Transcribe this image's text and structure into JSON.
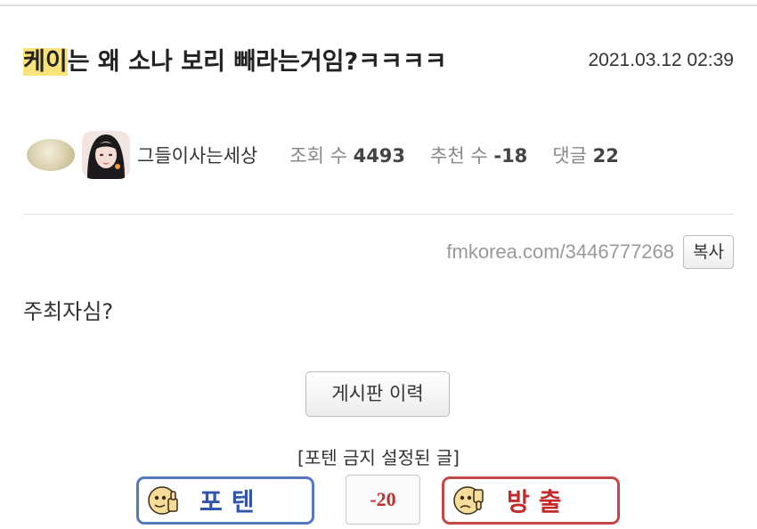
{
  "post": {
    "title_highlight": "케이",
    "title_rest": "는 왜 소나 보리 빼라는거임?ㅋㅋㅋㅋ",
    "date": "2021.03.12 02:39"
  },
  "author": {
    "nickname": "그들이사는세상"
  },
  "stats": {
    "views_label": "조회 수",
    "views": "4493",
    "recommend_label": "추천 수",
    "recommend": "-18",
    "comments_label": "댓글",
    "comments": "22"
  },
  "link": {
    "url": "fmkorea.com/3446777268",
    "copy_label": "복사"
  },
  "content": {
    "body": "주최자심?"
  },
  "board_history_label": "게시판 이력",
  "notice": "[포텐 금지 설정된 글]",
  "vote": {
    "up_label": "포텐",
    "score": "-20",
    "down_label": "방출"
  },
  "colors": {
    "highlight": "#f8e27a",
    "up_border": "#5577bf",
    "down_border": "#c34848",
    "score_text": "#c13030"
  }
}
